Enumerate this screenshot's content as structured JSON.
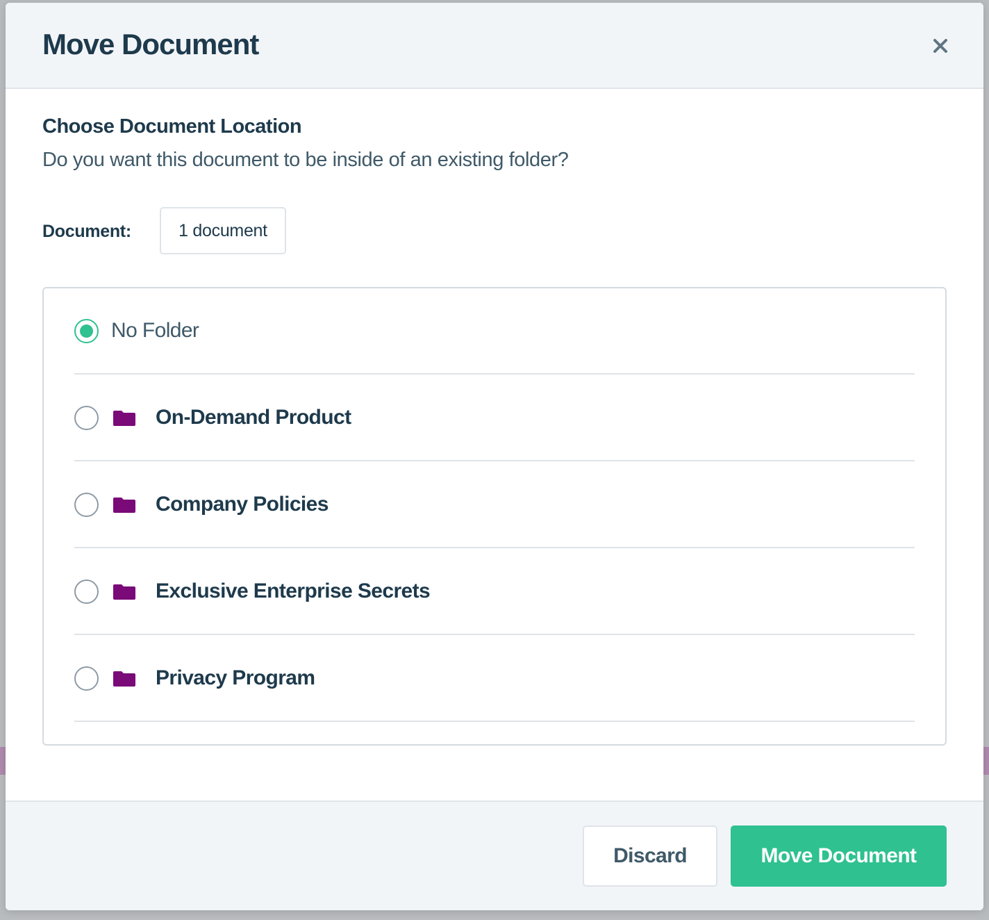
{
  "modal": {
    "title": "Move Document",
    "close_icon": "close-icon"
  },
  "body": {
    "section_title": "Choose Document Location",
    "section_subtitle": "Do you want this document to be inside of an existing folder?",
    "document_label": "Document:",
    "document_count": "1 document"
  },
  "folders": [
    {
      "label": "No Folder",
      "selected": true,
      "icon": null
    },
    {
      "label": "On-Demand Product",
      "selected": false,
      "icon": "folder-icon"
    },
    {
      "label": "Company Policies",
      "selected": false,
      "icon": "folder-icon"
    },
    {
      "label": "Exclusive Enterprise Secrets",
      "selected": false,
      "icon": "folder-icon"
    },
    {
      "label": "Privacy Program",
      "selected": false,
      "icon": "folder-icon"
    }
  ],
  "footer": {
    "discard_label": "Discard",
    "move_label": "Move Document"
  },
  "colors": {
    "accent": "#2fc190",
    "folder": "#7a0a78",
    "heading": "#1e3a4c",
    "text": "#3f5968"
  }
}
